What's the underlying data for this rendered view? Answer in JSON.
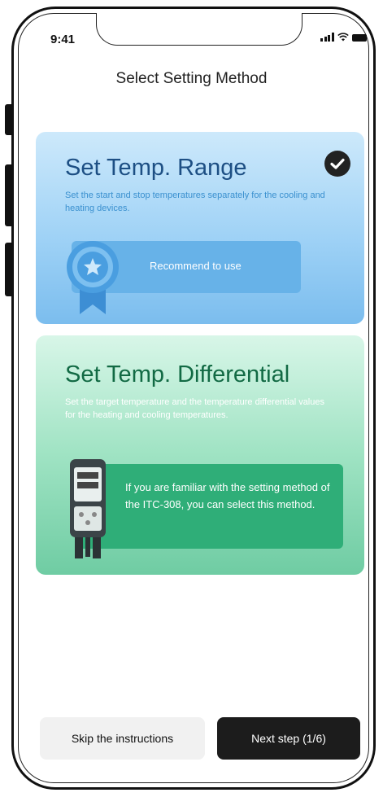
{
  "status_bar": {
    "time": "9:41"
  },
  "page": {
    "title": "Select Setting Method"
  },
  "options": {
    "range": {
      "title": "Set Temp. Range",
      "description": "Set the start and stop temperatures separately for the cooling and heating devices.",
      "recommend_label": "Recommend to use",
      "selected": true
    },
    "differential": {
      "title": "Set Temp. Differential",
      "description": "Set the target temperature and the temperature differential values for the heating and cooling temperatures.",
      "info_text": "If you are familiar with the setting method of the ITC-308, you can select this method.",
      "selected": false
    }
  },
  "footer": {
    "skip_label": "Skip the instructions",
    "next_label": "Next step (1/6)"
  },
  "colors": {
    "range_title": "#1d4f84",
    "differential_title": "#126a44",
    "next_button_bg": "#1c1c1c"
  }
}
